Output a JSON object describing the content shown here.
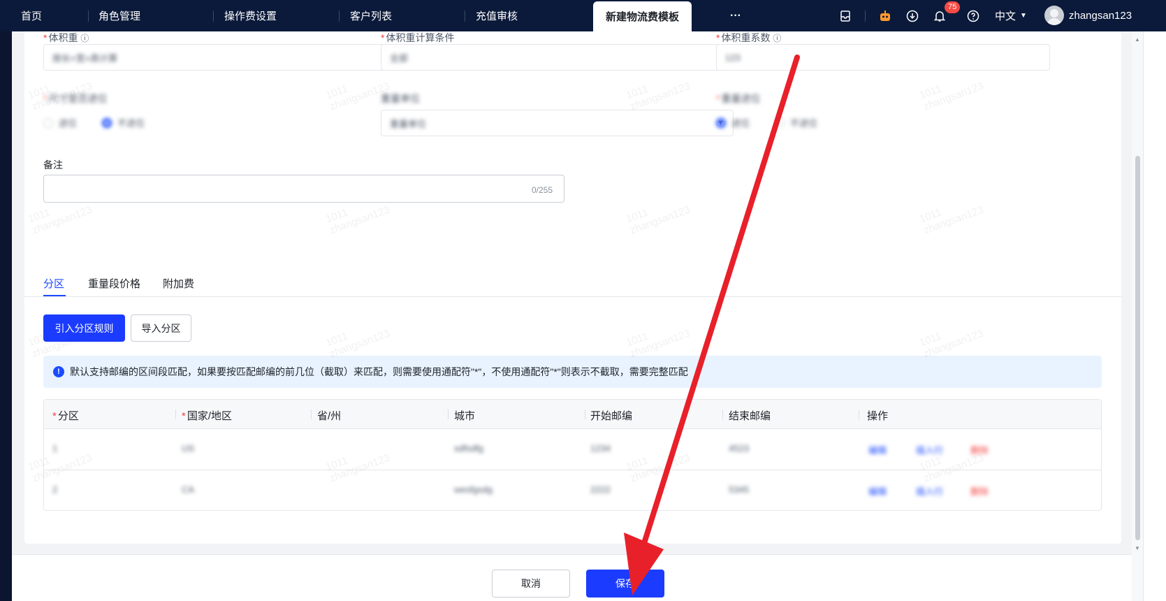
{
  "topbar": {
    "tabs": [
      "首页",
      "角色管理",
      "操作费设置",
      "客户列表",
      "充值审核"
    ],
    "active_tab": "新建物流费模板",
    "more": "···",
    "notification_count": "75",
    "language": "中文",
    "username": "zhangsan123"
  },
  "form": {
    "volume_weight_label": "体积重",
    "volume_weight_value": "按长×宽×高计算",
    "volume_condition_label": "体积重计算条件",
    "volume_condition_value": "全部",
    "volume_coeff_label": "体积重系数",
    "volume_coeff_value": "123",
    "size_round_label": "尺寸是否进位",
    "round_options": [
      "进位",
      "不进位"
    ],
    "weight_unit_label": "重量单位",
    "weight_unit_value": "重量单位",
    "weight_round_label": "重量进位",
    "remark_label": "备注",
    "remark_counter": "0/255",
    "required_mark": "*"
  },
  "section": {
    "tabs": [
      "分区",
      "重量段价格",
      "附加费"
    ],
    "btn_import_rules": "引入分区规则",
    "btn_import_zone": "导入分区",
    "notice": "默认支持邮编的区间段匹配，如果要按匹配邮编的前几位（截取）来匹配，则需要使用通配符\"*\"，不使用通配符\"*\"则表示不截取，需要完整匹配",
    "notice_icon": "!"
  },
  "table": {
    "columns": [
      "分区",
      "国家/地区",
      "省/州",
      "城市",
      "开始邮编",
      "结束邮编",
      "操作"
    ],
    "rows": [
      {
        "zone": "1",
        "country": "US",
        "province": "",
        "city": "sdfsdfg",
        "start": "1234",
        "end": "4523"
      },
      {
        "zone": "2",
        "country": "CA",
        "province": "",
        "city": "wesfgsdg",
        "start": "2222",
        "end": "5345"
      }
    ],
    "actions": [
      "编辑",
      "插入行",
      "删除"
    ]
  },
  "footer": {
    "cancel": "取消",
    "save": "保存"
  },
  "watermark": {
    "line1": "1011",
    "line2": "zhangsan123"
  },
  "colors": {
    "primary": "#1b3cff",
    "topbar": "#0b1a3a",
    "danger": "#f53f3f",
    "arrow": "#e8202a"
  }
}
